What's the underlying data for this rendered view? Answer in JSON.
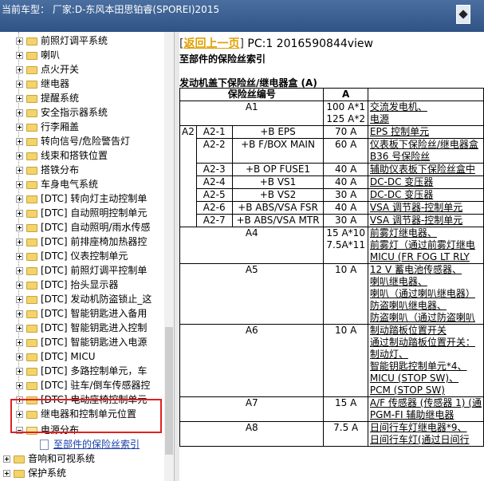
{
  "window": {
    "title": "当前车型：  厂家:D-东风本田思铂睿(SPOREI)2015"
  },
  "tree": {
    "items": [
      {
        "label": "前照灯调平系统",
        "type": "folder"
      },
      {
        "label": "喇叭",
        "type": "folder"
      },
      {
        "label": "点火开关",
        "type": "folder"
      },
      {
        "label": "继电器",
        "type": "folder"
      },
      {
        "label": "提醒系统",
        "type": "folder"
      },
      {
        "label": "安全指示器系统",
        "type": "folder"
      },
      {
        "label": "行李厢盖",
        "type": "folder"
      },
      {
        "label": "转向信号/危险警告灯",
        "type": "folder"
      },
      {
        "label": "线束和搭铁位置",
        "type": "folder"
      },
      {
        "label": "搭铁分布",
        "type": "folder"
      },
      {
        "label": "车身电气系统",
        "type": "folder"
      },
      {
        "label": "[DTC] 转向灯主动控制单",
        "type": "folder"
      },
      {
        "label": "[DTC] 自动照明控制单元",
        "type": "folder"
      },
      {
        "label": "[DTC] 自动照明/雨水传感",
        "type": "folder"
      },
      {
        "label": "[DTC] 前排座椅加热器控",
        "type": "folder"
      },
      {
        "label": "[DTC] 仪表控制单元",
        "type": "folder"
      },
      {
        "label": "[DTC] 前照灯调平控制单",
        "type": "folder"
      },
      {
        "label": "[DTC] 抬头显示器",
        "type": "folder"
      },
      {
        "label": "[DTC] 发动机防盗锁止_这",
        "type": "folder"
      },
      {
        "label": "[DTC] 智能钥匙进入备用",
        "type": "folder"
      },
      {
        "label": "[DTC] 智能钥匙进入控制",
        "type": "folder"
      },
      {
        "label": "[DTC] 智能钥匙进入电源",
        "type": "folder"
      },
      {
        "label": "[DTC] MICU",
        "type": "folder"
      },
      {
        "label": "[DTC] 多路控制单元，车",
        "type": "folder"
      },
      {
        "label": "[DTC] 驻车/倒车传感器控",
        "type": "folder"
      },
      {
        "label": "[DTC] 电动座椅控制单元",
        "type": "folder"
      },
      {
        "label": "继电器和控制单元位置",
        "type": "folder"
      }
    ],
    "open_folder": "电源分布",
    "selected_doc": "至部件的保险丝索引",
    "after": [
      {
        "label": "音响和可视系统"
      },
      {
        "label": "保护系统"
      }
    ]
  },
  "content": {
    "back_link": "返回上一页",
    "pc_label": "PC:1 2016590844view",
    "heading": "至部件的保险丝索引",
    "subheading": "发动机盖下保险丝/继电器盒 (A)",
    "col_fuse": "保险丝编号",
    "col_a": "A",
    "rows": [
      {
        "num": "A1",
        "sub": "",
        "name": "",
        "amp": "100 A*1 / 125 A*2",
        "desc": "交流发电机、 / 电源"
      },
      {
        "num": "A2",
        "sub": "A2-1",
        "name": "+B EPS",
        "amp": "70 A",
        "desc": "EPS 控制单元"
      },
      {
        "num": "",
        "sub": "A2-2",
        "name": "+B F/BOX MAIN",
        "amp": "60 A",
        "desc": "仪表板下保险丝/继电器盒 / B36 号保险丝"
      },
      {
        "num": "",
        "sub": "A2-3",
        "name": "+B OP FUSE1",
        "amp": "40 A",
        "desc": "辅助仪表板下保险丝盒中"
      },
      {
        "num": "",
        "sub": "A2-4",
        "name": "+B VS1",
        "amp": "40 A",
        "desc": "DC-DC 变压器"
      },
      {
        "num": "",
        "sub": "A2-5",
        "name": "+B VS2",
        "amp": "30 A",
        "desc": "DC-DC 变压器"
      },
      {
        "num": "",
        "sub": "A2-6",
        "name": "+B ABS/VSA FSR",
        "amp": "40 A",
        "desc": "VSA 调节器-控制单元"
      },
      {
        "num": "",
        "sub": "A2-7",
        "name": "+B ABS/VSA MTR",
        "amp": "30 A",
        "desc": "VSA 调节器-控制单元"
      },
      {
        "num": "A4",
        "sub": "",
        "name": "",
        "amp": "15 A*10 / 7.5A*11",
        "desc": "前雾灯继电器、 / 前雾灯（通过前雾灯继电 / MICU (FR FOG LT RLY"
      },
      {
        "num": "A5",
        "sub": "",
        "name": "",
        "amp": "10 A",
        "desc": "12 V 蓄电池传感器、 / 喇叭继电器、 / 喇叭（通过喇叭继电器） / 防盗喇叭继电器、 / 防盗喇叭（通过防盗喇叭"
      },
      {
        "num": "A6",
        "sub": "",
        "name": "",
        "amp": "10 A",
        "desc": "制动踏板位置开关 / 通过制动踏板位置开关： / 制动灯、 / 智能钥匙控制单元*4、 / MICU (STOP SW)、 / PCM (STOP SW)"
      },
      {
        "num": "A7",
        "sub": "",
        "name": "",
        "amp": "15 A",
        "desc": "A/F 传感器 (传感器 1) (通 / PGM-FI 辅助继电器"
      },
      {
        "num": "A8",
        "sub": "",
        "name": "",
        "amp": "7.5 A",
        "desc": "日间行车灯继电器*9、 / 日间行车灯(通过日间行"
      }
    ]
  }
}
